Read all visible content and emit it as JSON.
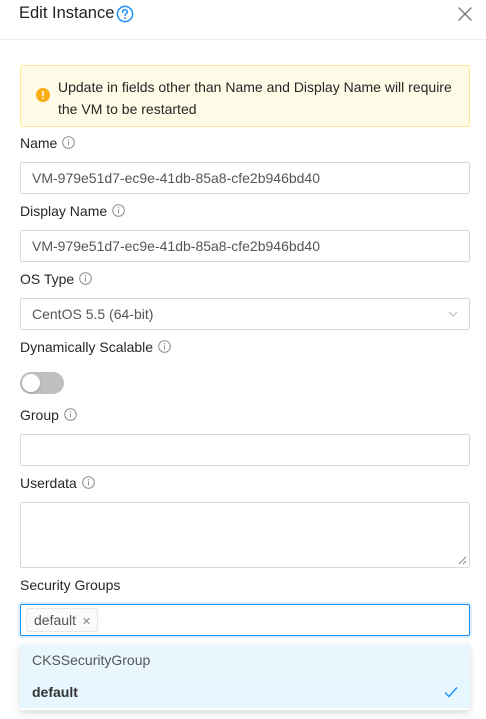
{
  "dialog": {
    "title": "Edit Instance"
  },
  "alert": {
    "message": "Update in fields other than Name and Display Name will require the VM to be restarted"
  },
  "fields": {
    "name": {
      "label": "Name",
      "value": "VM-979e51d7-ec9e-41db-85a8-cfe2b946bd40"
    },
    "display_name": {
      "label": "Display Name",
      "value": "VM-979e51d7-ec9e-41db-85a8-cfe2b946bd40"
    },
    "os_type": {
      "label": "OS Type",
      "value": "CentOS 5.5 (64-bit)"
    },
    "dynamically_scalable": {
      "label": "Dynamically Scalable",
      "enabled": false
    },
    "group": {
      "label": "Group",
      "value": ""
    },
    "userdata": {
      "label": "Userdata",
      "value": ""
    },
    "security_groups": {
      "label": "Security Groups",
      "selected": [
        "default"
      ],
      "options": [
        {
          "label": "CKSSecurityGroup",
          "selected": false
        },
        {
          "label": "default",
          "selected": true
        }
      ]
    }
  },
  "icons": {
    "help": "question-circle-icon",
    "close": "close-icon",
    "alert": "exclamation-circle-icon",
    "info": "info-circle-icon",
    "select_arrow": "chevron-down-icon",
    "check": "check-icon"
  },
  "colors": {
    "primary": "#1890ff",
    "warning": "#faad14",
    "alert_bg": "#fffbe6",
    "alert_border": "#ffe58f",
    "switch_off": "#bfbfbf"
  }
}
